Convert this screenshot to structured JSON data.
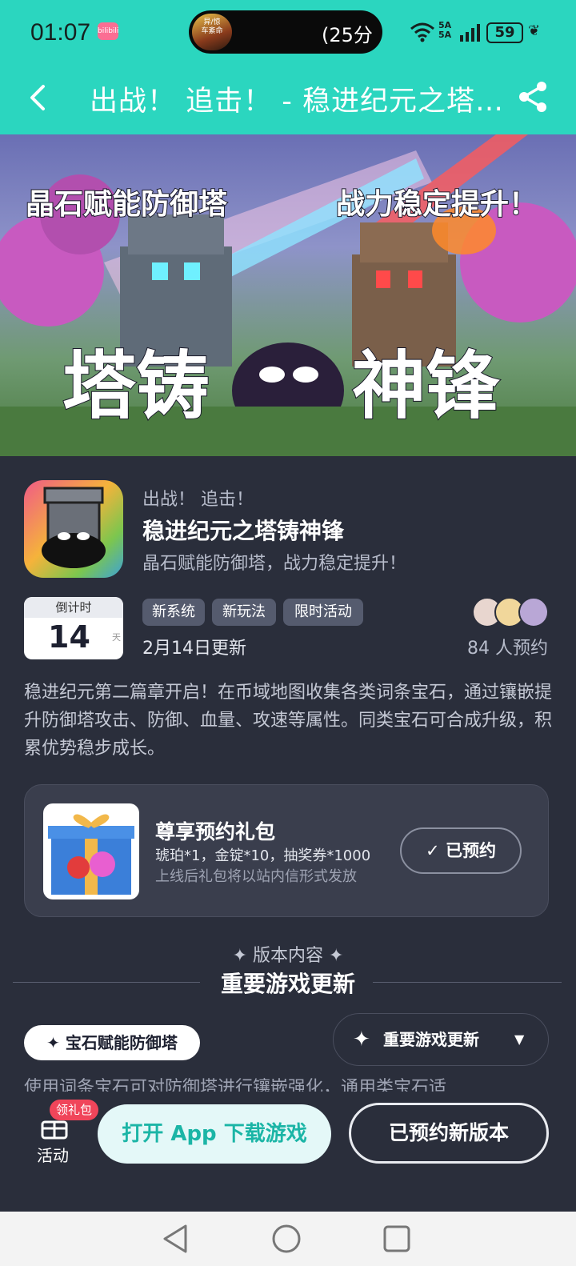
{
  "status_bar": {
    "time": "01:07",
    "app_badge": "bilibili",
    "island_thumb_text": "异/惊\n车紊命",
    "island_text": "(25分",
    "signal": "5A\n5A",
    "battery": "59"
  },
  "header": {
    "title": "出战！ 追击！ - 稳进纪元之塔…",
    "back_icon": "chevron-left-icon",
    "share_icon": "share-icon"
  },
  "banner": {
    "left_caption": "晶石赋能防御塔",
    "right_caption": "战力稳定提升！",
    "logo_left": "塔铸",
    "logo_right": "神锋"
  },
  "app": {
    "subtitle": "出战！ 追击！",
    "name": "稳进纪元之塔铸神锋",
    "tagline": "晶石赋能防御塔，战力稳定提升！"
  },
  "countdown": {
    "label": "倒计时",
    "value": "14",
    "unit": "天"
  },
  "tags": [
    "新系统",
    "新玩法",
    "限时活动"
  ],
  "update_date": "2月14日更新",
  "reservations": "84 人预约",
  "description": "稳进纪元第二篇章开启！在币域地图收集各类词条宝石，通过镶嵌提升防御塔攻击、防御、血量、攻速等属性。同类宝石可合成升级，积累优势稳步成长。",
  "gift": {
    "title": "尊享预约礼包",
    "items": "琥珀*1，金锭*10，抽奖券*1000",
    "note": "上线后礼包将以站内信形式发放",
    "button": "已预约"
  },
  "version": {
    "small_title": "✦ 版本内容 ✦",
    "big_title": "重要游戏更新",
    "pill": "✦ 宝石赋能防御塔",
    "dropdown": "重要游戏更新",
    "preview_text": "使用词条宝石可对防御塔进行镶嵌强化，通用类宝石适"
  },
  "bottom": {
    "activity_badge": "领礼包",
    "activity_label": "活动",
    "open_app": "打开 App 下载游戏",
    "reserved_version": "已预约新版本"
  },
  "colors": {
    "accent": "#2bd6bf",
    "background": "#2a2e3b",
    "tag": "#555b6e"
  }
}
